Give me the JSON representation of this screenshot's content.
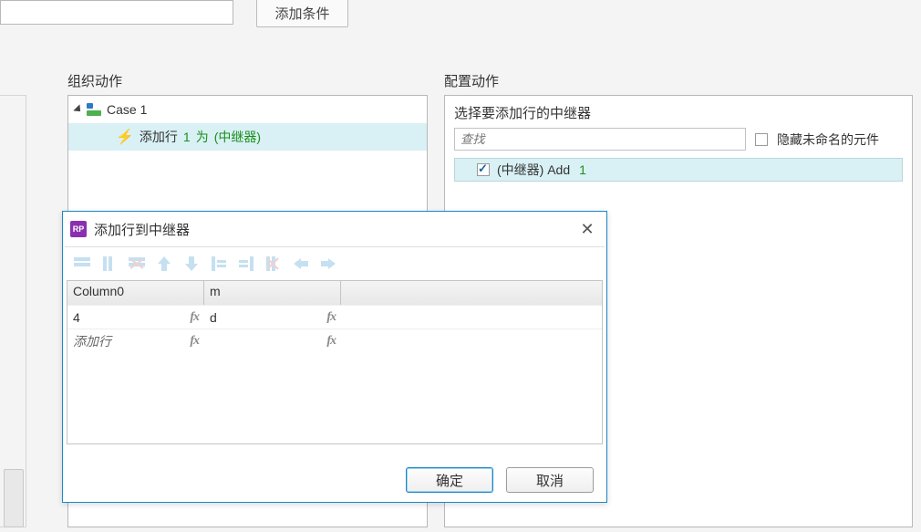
{
  "toolbar": {
    "add_condition": "添加条件"
  },
  "sections": {
    "organize": "组织动作",
    "configure": "配置动作"
  },
  "organize": {
    "case_label": "Case 1",
    "action_prefix": "添加行",
    "action_count": "1",
    "action_mid": "为",
    "action_target": "(中继器)"
  },
  "configure": {
    "title": "选择要添加行的中继器",
    "search_placeholder": "查找",
    "hide_unnamed": "隐藏未命名的元件",
    "hide_unnamed_checked": false,
    "target_label": "(中继器) Add",
    "target_count": "1",
    "target_checked": true
  },
  "dialog": {
    "badge": "RP",
    "title": "添加行到中继器",
    "columns": [
      "Column0",
      "m",
      ""
    ],
    "rows": [
      {
        "c0": "4",
        "c1": "d",
        "c2": ""
      },
      {
        "c0": "添加行",
        "c0_italic": true,
        "c1": "",
        "c2": ""
      }
    ],
    "ok": "确定",
    "cancel": "取消"
  }
}
